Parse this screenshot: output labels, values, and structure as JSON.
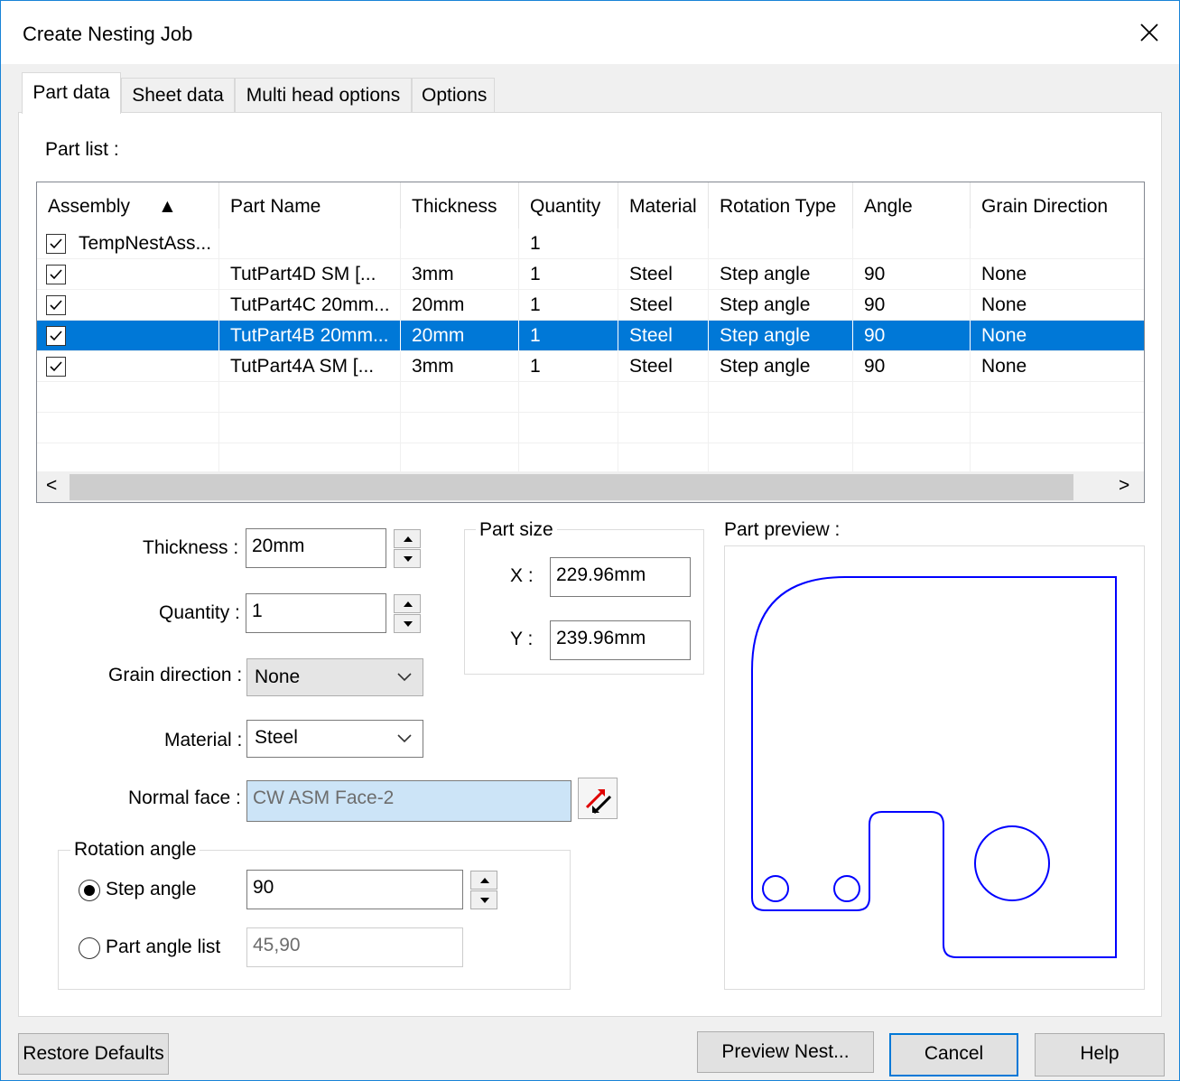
{
  "window": {
    "title": "Create Nesting Job"
  },
  "tabs": [
    {
      "label": "Part data",
      "active": true
    },
    {
      "label": "Sheet data",
      "active": false
    },
    {
      "label": "Multi head options",
      "active": false
    },
    {
      "label": "Options",
      "active": false
    }
  ],
  "part_list": {
    "label": "Part list :",
    "sort_indicator": "▲",
    "columns": [
      "Assembly",
      "Part Name",
      "Thickness",
      "Quantity",
      "Material",
      "Rotation Type",
      "Angle",
      "Grain Direction"
    ],
    "rows": [
      {
        "checked": true,
        "assembly": "TempNestAss...",
        "part_name": "",
        "thickness": "",
        "quantity": "1",
        "material": "",
        "rotation_type": "",
        "angle": "",
        "grain_direction": ""
      },
      {
        "checked": true,
        "assembly": "",
        "part_name": "TutPart4D SM [...",
        "thickness": "3mm",
        "quantity": "1",
        "material": "Steel",
        "rotation_type": "Step angle",
        "angle": "90",
        "grain_direction": "None"
      },
      {
        "checked": true,
        "assembly": "",
        "part_name": "TutPart4C 20mm...",
        "thickness": "20mm",
        "quantity": "1",
        "material": "Steel",
        "rotation_type": "Step angle",
        "angle": "90",
        "grain_direction": "None"
      },
      {
        "checked": true,
        "assembly": "",
        "part_name": "TutPart4B 20mm...",
        "thickness": "20mm",
        "quantity": "1",
        "material": "Steel",
        "rotation_type": "Step angle",
        "angle": "90",
        "grain_direction": "None",
        "selected": true
      },
      {
        "checked": true,
        "assembly": "",
        "part_name": "TutPart4A SM [...",
        "thickness": "3mm",
        "quantity": "1",
        "material": "Steel",
        "rotation_type": "Step angle",
        "angle": "90",
        "grain_direction": "None"
      }
    ],
    "scroll_left": "<",
    "scroll_right": ">"
  },
  "form": {
    "thickness_label": "Thickness :",
    "thickness_value": "20mm",
    "quantity_label": "Quantity :",
    "quantity_value": "1",
    "grain_label": "Grain direction :",
    "grain_value": "None",
    "material_label": "Material :",
    "material_value": "Steel",
    "normal_face_label": "Normal face :",
    "normal_face_value": "CW ASM Face-2"
  },
  "part_size": {
    "title": "Part size",
    "x_label": "X :",
    "x_value": "229.96mm",
    "y_label": "Y :",
    "y_value": "239.96mm"
  },
  "preview": {
    "label": "Part preview :"
  },
  "rotation": {
    "title": "Rotation angle",
    "step_label": "Step angle",
    "step_value": "90",
    "list_label": "Part angle list",
    "list_value": "45,90",
    "selected": "step"
  },
  "buttons": {
    "restore": "Restore Defaults",
    "preview": "Preview Nest...",
    "cancel": "Cancel",
    "help": "Help"
  },
  "colors": {
    "selection": "#0078d7",
    "preview_stroke": "#0000ff",
    "face_field": "#cce4f7"
  }
}
